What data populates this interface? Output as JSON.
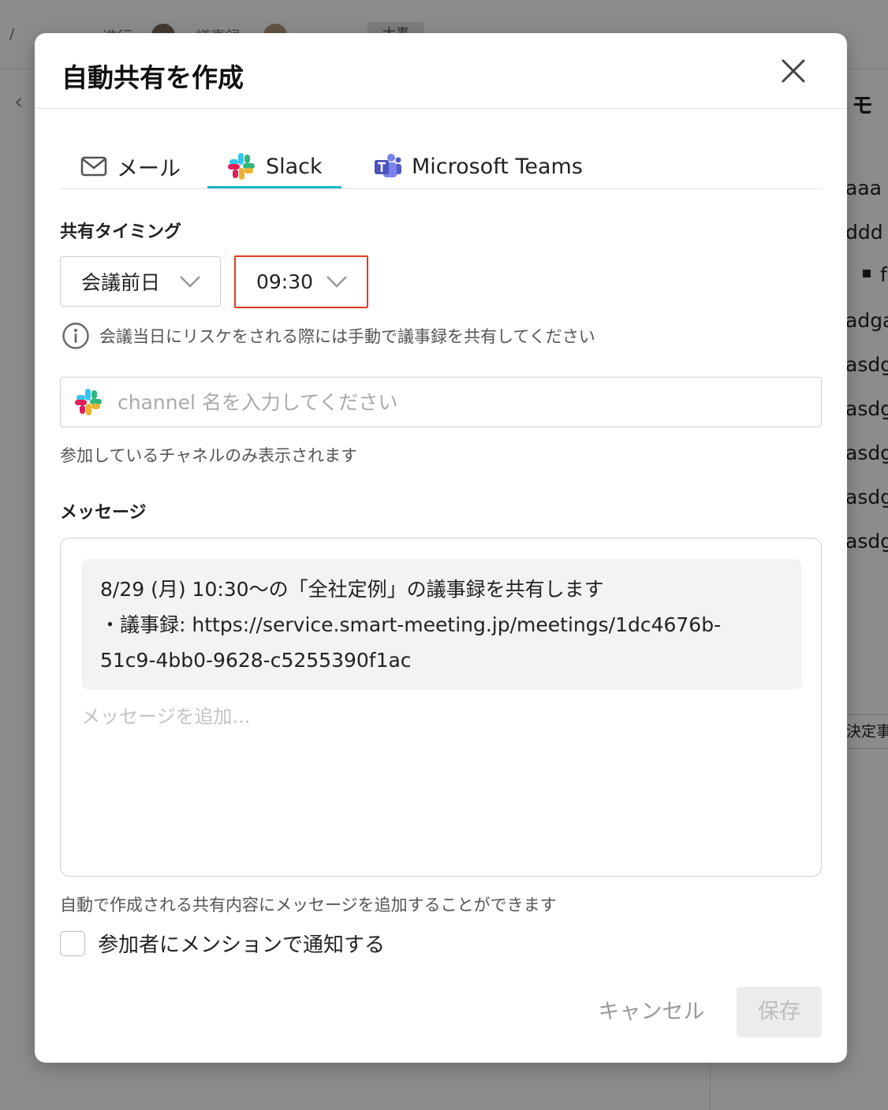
{
  "background": {
    "breadcrumb_1": "進行",
    "breadcrumb_2": "議事録",
    "chip": "大事",
    "right_panel_title": "モ",
    "right_lines": [
      "aaa",
      "ddd",
      "f",
      "adga",
      "asdg",
      "asdg",
      "asdg",
      "asdg",
      "asdg"
    ],
    "right_button": "決定事"
  },
  "modal": {
    "title": "自動共有を作成",
    "tabs": [
      {
        "label": "メール",
        "icon": "mail-icon",
        "active": false
      },
      {
        "label": "Slack",
        "icon": "slack-icon",
        "active": true
      },
      {
        "label": "Microsoft Teams",
        "icon": "teams-icon",
        "active": false
      }
    ],
    "timing": {
      "label": "共有タイミング",
      "day_value": "会議前日",
      "time_value": "09:30",
      "info": "会議当日にリスケをされる際には手動で議事録を共有してください"
    },
    "channel": {
      "value": "",
      "placeholder": "channel 名を入力してください",
      "hint": "参加しているチャネルのみ表示されます"
    },
    "message": {
      "label": "メッセージ",
      "preview_lines": [
        "8/29 (月) 10:30〜の「全社定例」の議事録を共有します",
        "・議事録: https://service.smart-meeting.jp/meetings/1dc4676b-",
        "51c9-4bb0-9628-c5255390f1ac"
      ],
      "value": "",
      "placeholder": "メッセージを追加...",
      "hint": "自動で作成される共有内容にメッセージを追加することができます"
    },
    "mention_checkbox": {
      "label": "参加者にメンションで通知する",
      "checked": false
    },
    "cancel_label": "キャンセル",
    "save_label": "保存"
  },
  "colors": {
    "accent_tab_underline": "#1db3c7",
    "highlight_border": "#e23b22",
    "overlay": "rgba(0,0,0,0.45)"
  }
}
